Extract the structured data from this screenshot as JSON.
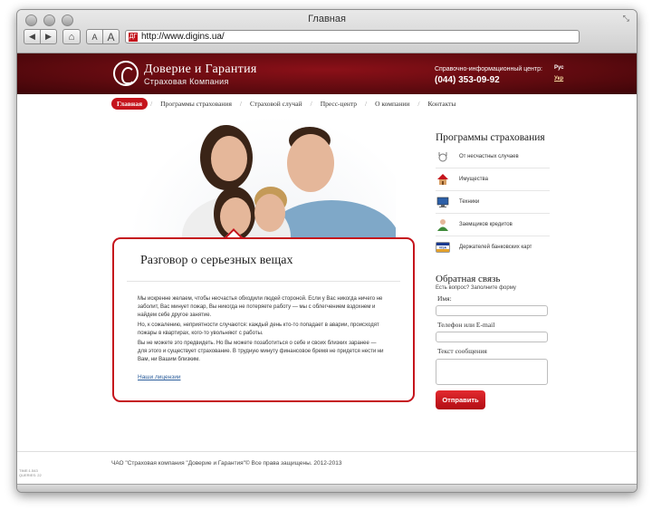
{
  "window": {
    "title": "Главная"
  },
  "browser": {
    "back_glyph": "◀",
    "forward_glyph": "▶",
    "home_glyph": "⌂",
    "font_small": "A",
    "font_large": "A",
    "url": "http://www.digins.ua/",
    "favicon_text": "ДГ"
  },
  "header": {
    "brand_name": "Доверие и Гарантия",
    "brand_sub": "Страховая Компания",
    "hotline_label": "Справочно-информационный центр:",
    "hotline_phone": "(044) 353-09-92",
    "lang_ru": "Рус",
    "lang_ua": "Укр"
  },
  "menu": {
    "items": [
      "Главная",
      "Программы страхования",
      "Страховой случай",
      "Пресс-центр",
      "О компании",
      "Контакты"
    ],
    "separator": "/"
  },
  "article": {
    "title": "Разговор о серьезных вещах",
    "p1": "Мы искренне желаем, чтобы несчастья обходили людей стороной. Если у Вас никогда ничего не заболит, Вас минует пожар, Вы никогда не потеряете работу — мы с облегчением вздохнем и найдем себе другое занятие.",
    "p2": "Но, к сожалению, неприятности случаются: каждый день кто-то попадает в аварии, происходят пожары в квартирах, кого-то увольняют с работы.",
    "p3": "Вы не можете это предвидеть. Но Вы можете позаботиться о себе и своих близких заранее — для этого и существует страхование. В трудную минуту финансовое бремя не придется нести ни Вам, ни Вашим близким.",
    "link": "Наши лицензии"
  },
  "programs": {
    "title": "Программы страхования",
    "items": [
      "От несчастных случаев",
      "Имущества",
      "Техники",
      "Заемщиков кредитов",
      "Держателей банковских карт"
    ],
    "icons": [
      "stethoscope-icon",
      "house-icon",
      "monitor-icon",
      "person-icon",
      "visa-card-icon"
    ]
  },
  "feedback": {
    "title": "Обратная связь",
    "subtitle": "Есть вопрос? Заполните форму",
    "name_label": "Имя:",
    "phone_label": "Телефон или E-mail",
    "message_label": "Текст сообщения",
    "submit": "Отправить"
  },
  "footer": {
    "copyright": "ЧАО \"Страховая компания \"Доверие и Гарантия\"© Все права защищены. 2012-2013",
    "debug": "TIME:1.543 QUERIES: 22"
  },
  "colors": {
    "brand_red": "#c5141c",
    "header_dark": "#5e0a0f"
  }
}
